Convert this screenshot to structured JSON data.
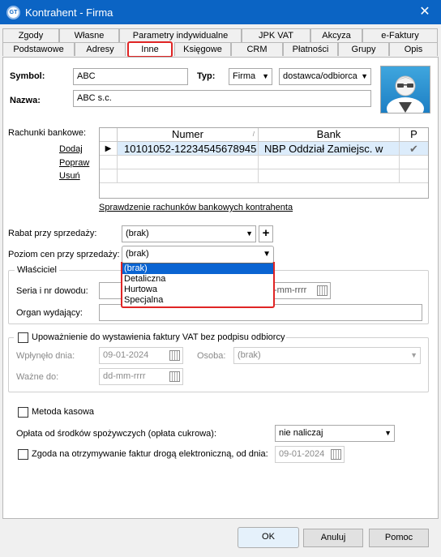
{
  "window": {
    "title": "Kontrahent - Firma",
    "icon_text": "GT",
    "close": "✕"
  },
  "tabs_row1": [
    "Zgody",
    "Własne",
    "Parametry indywidualne",
    "JPK VAT",
    "Akcyza",
    "e-Faktury"
  ],
  "tabs_row2": [
    "Podstawowe",
    "Adresy",
    "Inne",
    "Księgowe",
    "CRM",
    "Płatności",
    "Grupy",
    "Opis"
  ],
  "form": {
    "symbol_label": "Symbol:",
    "symbol_value": "ABC",
    "typ_label": "Typ:",
    "typ_value": "Firma",
    "typ2_value": "dostawca/odbiorca",
    "nazwa_label": "Nazwa:",
    "nazwa_value": "ABC s.c."
  },
  "bank": {
    "label": "Rachunki bankowe:",
    "actions": [
      "Dodaj",
      "Popraw",
      "Usuń"
    ],
    "headers": [
      "Numer",
      "Bank",
      "P"
    ],
    "row": {
      "marker": "▶",
      "numer": "10101052-12234545678945",
      "bank": "NBP Oddział Zamiejsc. w",
      "p": "✔"
    },
    "check_link": "Sprawdzenie rachunków bankowych kontrahenta"
  },
  "rabat": {
    "label": "Rabat przy sprzedaży:",
    "value": "(brak)",
    "plus": "+"
  },
  "poziom": {
    "label": "Poziom cen przy sprzedaży:",
    "value": "(brak)",
    "options": [
      "(brak)",
      "Detaliczna",
      "Hurtowa",
      "Specjalna"
    ],
    "selected_index": 0
  },
  "wlasciciel": {
    "legend": "Właściciel",
    "seria_label": "Seria i nr dowodu:",
    "date_placeholder": "-mm-rrrr",
    "organ_label": "Organ wydający:"
  },
  "upowaznienie": {
    "legend": "Upoważnienie do wystawienia faktury VAT bez podpisu odbiorcy",
    "wplynelo_label": "Wpłynęło dnia:",
    "wplynelo_value": "09-01-2024",
    "osoba_label": "Osoba:",
    "osoba_value": "(brak)",
    "wazne_label": "Ważne do:",
    "wazne_value": "dd-mm-rrrr"
  },
  "metoda": {
    "label": "Metoda kasowa"
  },
  "oplata": {
    "label": "Opłata od środków spożywczych (opłata cukrowa):",
    "value": "nie naliczaj"
  },
  "zgoda": {
    "label": "Zgoda na otrzymywanie faktur drogą elektroniczną, od dnia:",
    "value": "09-01-2024"
  },
  "buttons": {
    "ok": "OK",
    "anuluj": "Anuluj",
    "pomoc": "Pomoc"
  },
  "colors": {
    "titlebar": "#0b64c4",
    "highlight": "#e02525",
    "selection": "#0a64d2"
  }
}
